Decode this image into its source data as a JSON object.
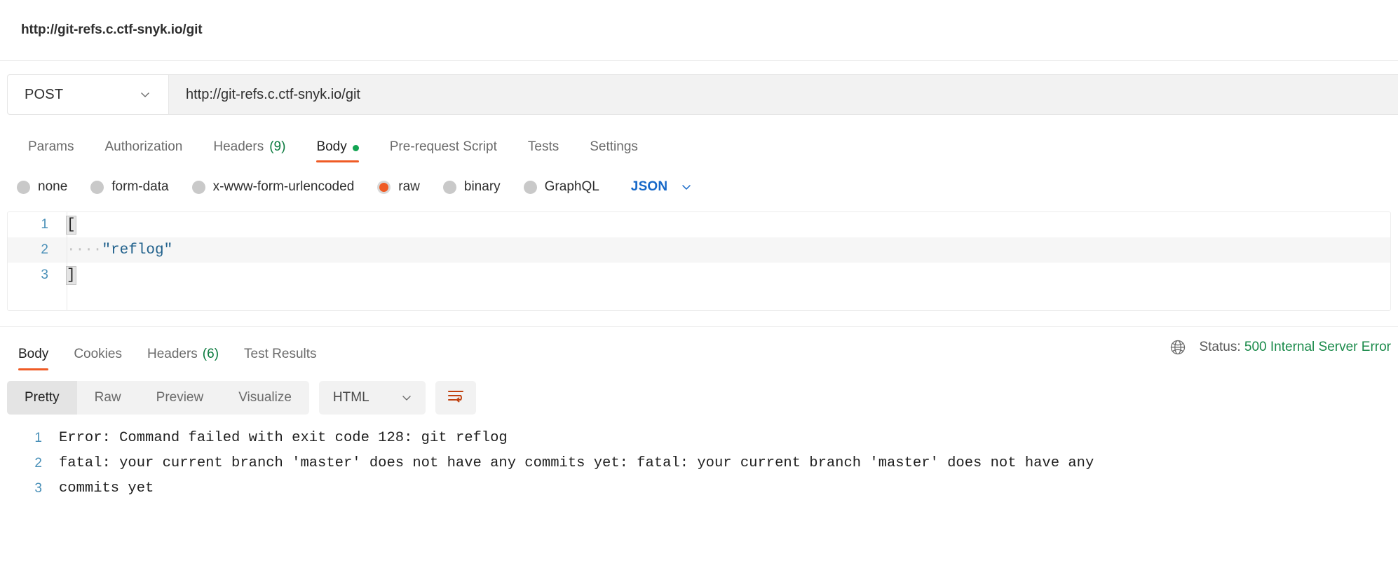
{
  "request": {
    "title": "http://git-refs.c.ctf-snyk.io/git",
    "method": "POST",
    "url": "http://git-refs.c.ctf-snyk.io/git",
    "tabs": [
      {
        "label": "Params",
        "active": false
      },
      {
        "label": "Authorization",
        "active": false
      },
      {
        "label": "Headers",
        "count": "(9)",
        "active": false
      },
      {
        "label": "Body",
        "active": true,
        "dot": true
      },
      {
        "label": "Pre-request Script",
        "active": false
      },
      {
        "label": "Tests",
        "active": false
      },
      {
        "label": "Settings",
        "active": false
      }
    ],
    "body_types": [
      {
        "label": "none",
        "selected": false
      },
      {
        "label": "form-data",
        "selected": false
      },
      {
        "label": "x-www-form-urlencoded",
        "selected": false
      },
      {
        "label": "raw",
        "selected": true
      },
      {
        "label": "binary",
        "selected": false
      },
      {
        "label": "GraphQL",
        "selected": false
      }
    ],
    "format": "JSON",
    "editor_lines": [
      {
        "num": "1",
        "open_bracket": "[",
        "text": "",
        "highlight": false
      },
      {
        "num": "2",
        "indent": "····",
        "text": "\"reflog\"",
        "highlight": true
      },
      {
        "num": "3",
        "open_bracket": "]",
        "text": "",
        "highlight": false
      }
    ]
  },
  "response": {
    "tabs": [
      {
        "label": "Body",
        "active": true
      },
      {
        "label": "Cookies",
        "active": false
      },
      {
        "label": "Headers",
        "count": "(6)",
        "active": false
      },
      {
        "label": "Test Results",
        "active": false
      }
    ],
    "status_label": "Status:",
    "status_value": "500 Internal Server Error",
    "view_modes": [
      {
        "label": "Pretty",
        "active": true
      },
      {
        "label": "Raw",
        "active": false
      },
      {
        "label": "Preview",
        "active": false
      },
      {
        "label": "Visualize",
        "active": false
      }
    ],
    "language": "HTML",
    "body_lines": [
      {
        "num": "1",
        "text": "Error: Command failed with exit code 128: git reflog"
      },
      {
        "num": "2",
        "text": "fatal: your current branch 'master' does not have any commits yet: fatal: your current branch 'master' does not have any"
      },
      {
        "num": "3",
        "text": "commits yet"
      }
    ]
  },
  "colors": {
    "accent": "#ef5b25",
    "link": "#1668c8",
    "success": "#1a8a4a",
    "dot": "#13a452"
  }
}
